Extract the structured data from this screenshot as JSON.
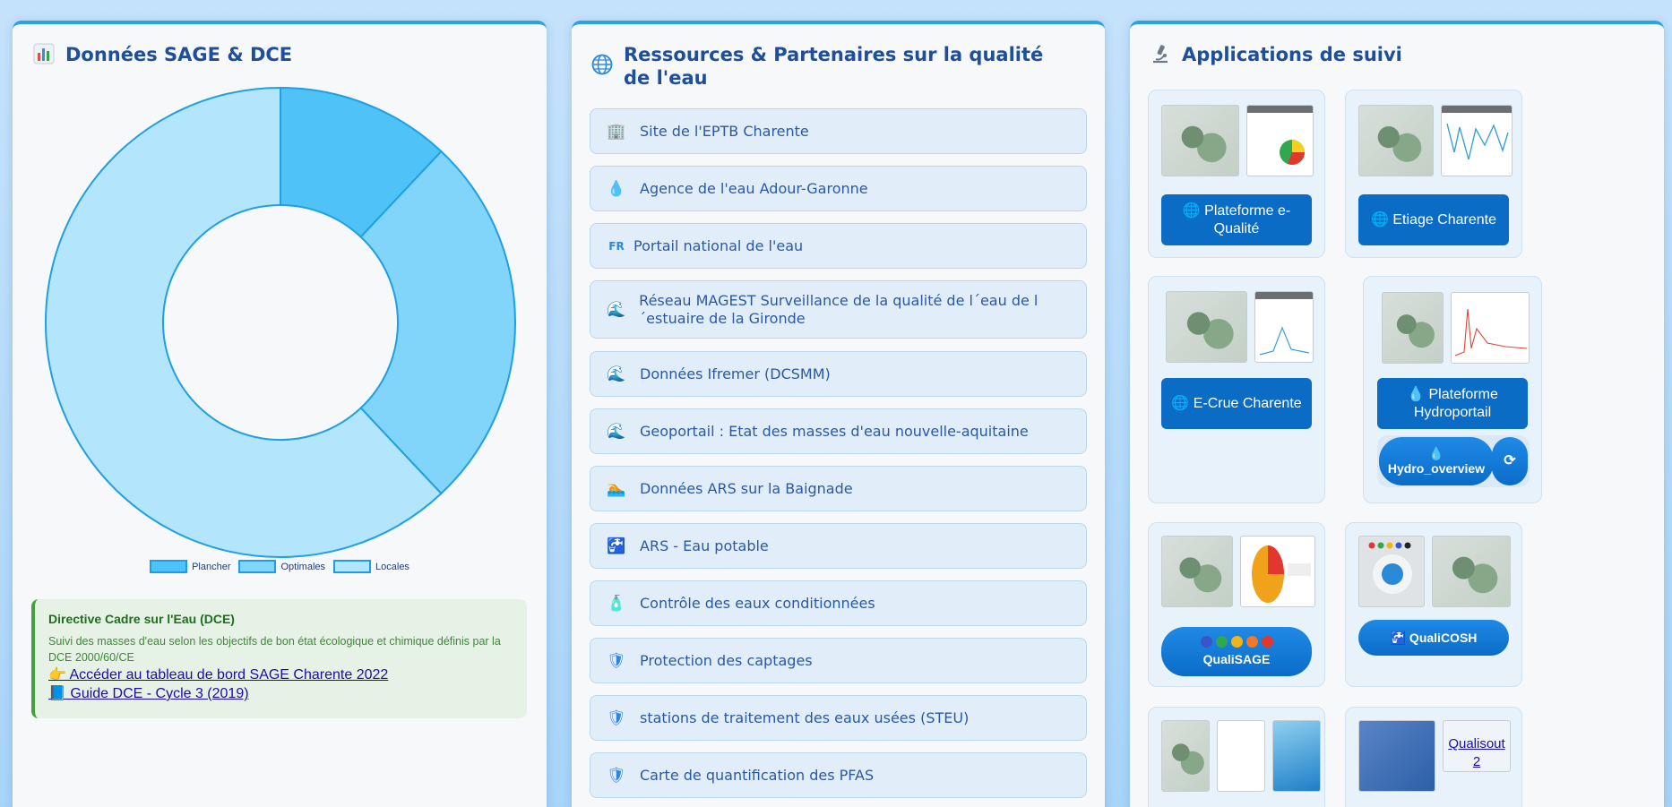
{
  "panel_sage": {
    "icon": "bar-chart-icon",
    "title": "Données SAGE & DCE",
    "chart_data": {
      "type": "pie",
      "categories": [
        "Plancher",
        "Optimales",
        "Locales"
      ],
      "values": [
        12,
        26,
        62
      ],
      "colors": [
        "#4fc3f7",
        "#81d4fa",
        "#b3e5fc"
      ],
      "legend_position": "bottom"
    },
    "dce": {
      "heading": "Directive Cadre sur l'Eau (DCE)",
      "description": "Suivi des masses d'eau selon les objectifs de bon état écologique et chimique définis par la DCE 2000/60/CE",
      "link1": "👉 Accéder au tableau de bord SAGE Charente 2022",
      "link2": "📘 Guide DCE - Cycle 3 (2019)"
    }
  },
  "panel_resources": {
    "icon": "globe-icon",
    "title": "Ressources & Partenaires sur la qualité de l'eau",
    "items": [
      {
        "icon": "🏢",
        "label": "Site de l'EPTB Charente"
      },
      {
        "icon": "💧",
        "label": "Agence de l'eau Adour-Garonne"
      },
      {
        "icon": "FR",
        "label": "Portail national de l'eau"
      },
      {
        "icon": "🌊",
        "label": "Réseau MAGEST Surveillance de la qualité de l´eau de l ´estuaire de la Gironde"
      },
      {
        "icon": "🌊",
        "label": "Données Ifremer (DCSMM)"
      },
      {
        "icon": "🌊",
        "label": "Geoportail : Etat des masses d'eau nouvelle-aquitaine"
      },
      {
        "icon": "🏊",
        "label": "Données ARS sur la Baignade"
      },
      {
        "icon": "🚰",
        "label": "ARS - Eau potable"
      },
      {
        "icon": "🧴",
        "label": "Contrôle des eaux conditionnées"
      },
      {
        "icon": "🛡",
        "label": "Protection des captages"
      },
      {
        "icon": "🛡",
        "label": "stations de traitement des eaux usées (STEU)"
      },
      {
        "icon": "🛡",
        "label": "Carte de quantification des PFAS"
      }
    ]
  },
  "panel_apps": {
    "icon": "microscope-icon",
    "title": "Applications de suivi",
    "apps": {
      "eq": "🌐 Plateforme e-Qualité",
      "etiage": "🌐 Etiage Charente",
      "ecrue": "🌐 E-Crue Charente",
      "hydroportail": "💧 Plateforme Hydroportail",
      "hydro_overview": "Hydro_overview",
      "hydro_overview_icon": "💧",
      "refresh": "⟳",
      "qualisage": "QualiSAGE",
      "qualicosh": "🚰 QualiCOSH",
      "qualisout_alt": "Qualisout 2"
    }
  }
}
